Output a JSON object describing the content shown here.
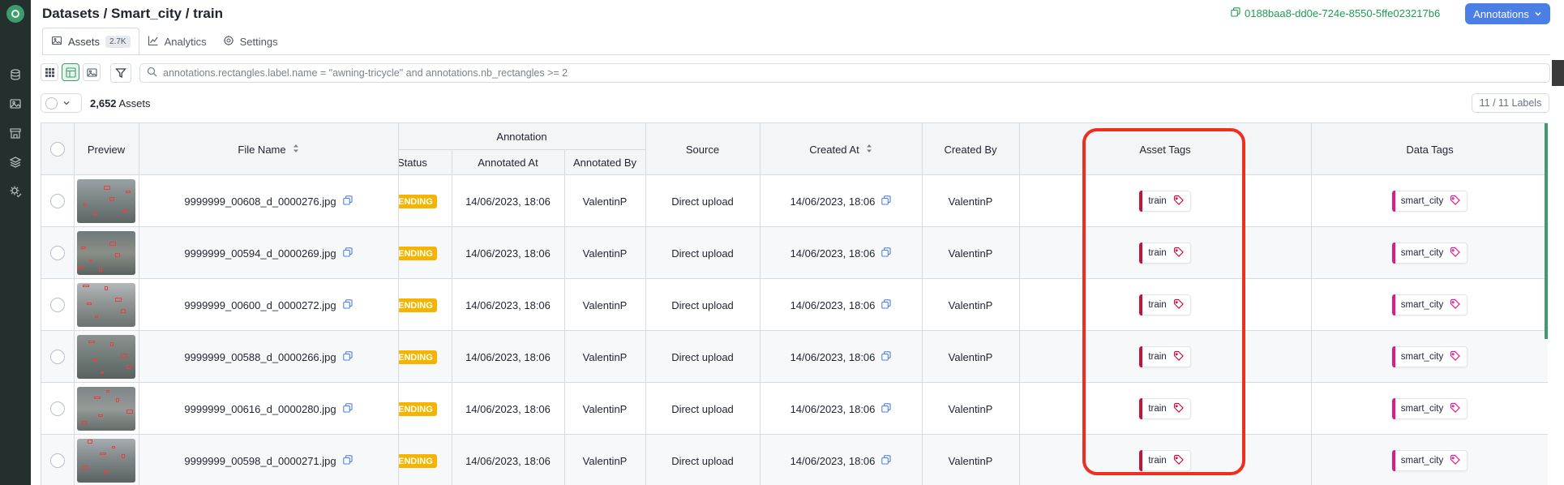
{
  "sidebar": {
    "items": [
      {
        "icon": "logo-icon"
      },
      {
        "icon": "database-icon"
      },
      {
        "icon": "image-icon"
      },
      {
        "icon": "shop-icon"
      },
      {
        "icon": "layers-icon"
      },
      {
        "icon": "settings-check-icon"
      }
    ]
  },
  "header": {
    "breadcrumb": [
      "Datasets",
      "Smart_city",
      "train"
    ],
    "separator": " / ",
    "dataset_id": "0188baa8-dd0e-724e-8550-5ffe023217b6",
    "annotations_button": "Annotations"
  },
  "tabs": [
    {
      "label": "Assets",
      "badge": "2.7K",
      "icon": "image-icon",
      "active": true
    },
    {
      "label": "Analytics",
      "icon": "chart-icon",
      "active": false
    },
    {
      "label": "Settings",
      "icon": "gear-icon",
      "active": false
    }
  ],
  "toolbar": {
    "search_query": "annotations.rectangles.label.name = \"awning-tricycle\" and annotations.nb_rectangles >= 2",
    "asset_count": "2,652",
    "asset_count_label": " Assets",
    "labels_button": "11 / 11 Labels"
  },
  "table": {
    "headers": {
      "preview": "Preview",
      "file_name": "File Name",
      "annotation_group": "Annotation",
      "status": "Status",
      "annotated_at": "Annotated At",
      "annotated_by": "Annotated By",
      "source": "Source",
      "created_at": "Created At",
      "created_by": "Created By",
      "asset_tags": "Asset Tags",
      "data_tags": "Data Tags"
    },
    "rows": [
      {
        "file_name": "9999999_00608_d_0000276.jpg",
        "status": "ENDING",
        "annotated_at": "14/06/2023, 18:06",
        "annotated_by": "ValentinP",
        "source": "Direct upload",
        "created_at": "14/06/2023, 18:06",
        "created_by": "ValentinP",
        "asset_tag": "train",
        "data_tag": "smart_city"
      },
      {
        "file_name": "9999999_00594_d_0000269.jpg",
        "status": "ENDING",
        "annotated_at": "14/06/2023, 18:06",
        "annotated_by": "ValentinP",
        "source": "Direct upload",
        "created_at": "14/06/2023, 18:06",
        "created_by": "ValentinP",
        "asset_tag": "train",
        "data_tag": "smart_city"
      },
      {
        "file_name": "9999999_00600_d_0000272.jpg",
        "status": "ENDING",
        "annotated_at": "14/06/2023, 18:06",
        "annotated_by": "ValentinP",
        "source": "Direct upload",
        "created_at": "14/06/2023, 18:06",
        "created_by": "ValentinP",
        "asset_tag": "train",
        "data_tag": "smart_city"
      },
      {
        "file_name": "9999999_00588_d_0000266.jpg",
        "status": "ENDING",
        "annotated_at": "14/06/2023, 18:06",
        "annotated_by": "ValentinP",
        "source": "Direct upload",
        "created_at": "14/06/2023, 18:06",
        "created_by": "ValentinP",
        "asset_tag": "train",
        "data_tag": "smart_city"
      },
      {
        "file_name": "9999999_00616_d_0000280.jpg",
        "status": "ENDING",
        "annotated_at": "14/06/2023, 18:06",
        "annotated_by": "ValentinP",
        "source": "Direct upload",
        "created_at": "14/06/2023, 18:06",
        "created_by": "ValentinP",
        "asset_tag": "train",
        "data_tag": "smart_city"
      },
      {
        "file_name": "9999999_00598_d_0000271.jpg",
        "status": "ENDING",
        "annotated_at": "14/06/2023, 18:06",
        "annotated_by": "ValentinP",
        "source": "Direct upload",
        "created_at": "14/06/2023, 18:06",
        "created_by": "ValentinP",
        "asset_tag": "train",
        "data_tag": "smart_city"
      }
    ]
  },
  "colors": {
    "sidebar_bg": "#23302d",
    "accent_green": "#3f9b6e",
    "uuid_green": "#1f9a53",
    "primary_blue": "#4c7fe6",
    "status_yellow": "#f4b400",
    "asset_tag_red": "#c0163a",
    "data_tag_pink": "#e0198c",
    "highlight_red": "#ee2e1f"
  }
}
